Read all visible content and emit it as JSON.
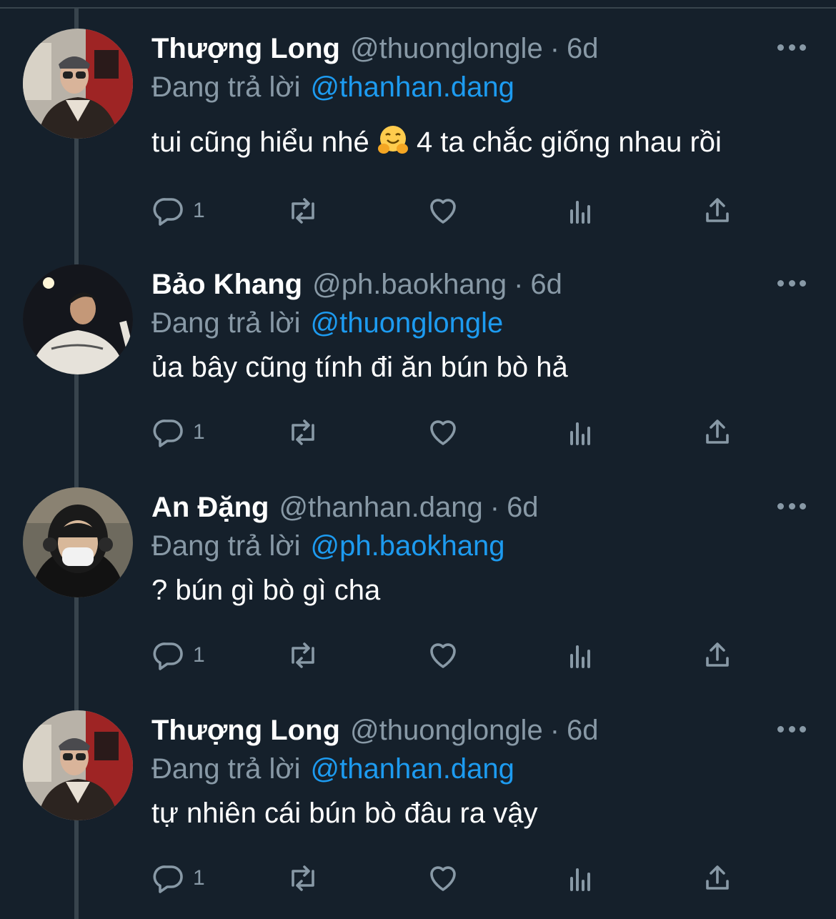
{
  "tweets": [
    {
      "name": "Thượng Long",
      "handle": "@thuonglongle",
      "separator": "·",
      "time": "6d",
      "reply_prefix": "Đang trả lời",
      "reply_to": "@thanhan.dang",
      "text_before_emoji": "tui cũng hiểu nhé",
      "emoji": "hugging-face-emoji",
      "text_after_emoji": "4 ta chắc giống nhau rồi",
      "reply_count": "1"
    },
    {
      "name": "Bảo Khang",
      "handle": "@ph.baokhang",
      "separator": "·",
      "time": "6d",
      "reply_prefix": "Đang trả lời",
      "reply_to": "@thuonglongle",
      "text": "ủa bây cũng tính đi ăn bún bò hả",
      "reply_count": "1"
    },
    {
      "name": "An Đặng",
      "handle": "@thanhan.dang",
      "separator": "·",
      "time": "6d",
      "reply_prefix": "Đang trả lời",
      "reply_to": "@ph.baokhang",
      "text": "? bún gì bò gì cha",
      "reply_count": "1"
    },
    {
      "name": "Thượng Long",
      "handle": "@thuonglongle",
      "separator": "·",
      "time": "6d",
      "reply_prefix": "Đang trả lời",
      "reply_to": "@thanhan.dang",
      "text": "tự nhiên cái bún bò đâu ra vậy",
      "reply_count": "1"
    }
  ],
  "colors": {
    "background": "#15202b",
    "secondary_text": "#8899a6",
    "mention": "#1d9bf0",
    "divider": "#38444d"
  },
  "icons": [
    "reply-icon",
    "retweet-icon",
    "like-icon",
    "analytics-icon",
    "share-icon",
    "more-icon"
  ]
}
